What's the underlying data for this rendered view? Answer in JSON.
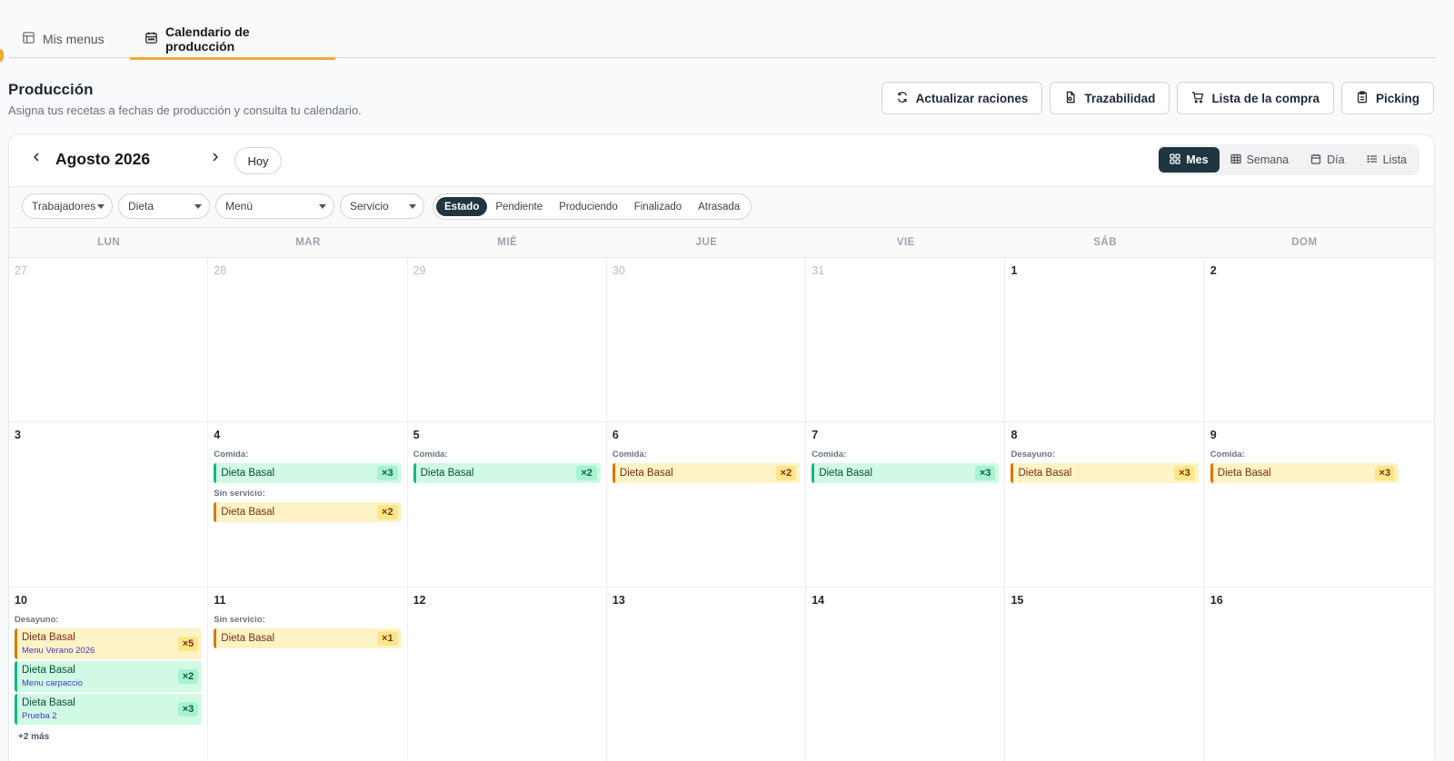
{
  "tabs": [
    {
      "label": "Mis menus"
    },
    {
      "label": "Calendario de producción"
    }
  ],
  "header": {
    "title": "Producción",
    "subtitle": "Asigna tus recetas a fechas de producción y consulta tu calendario."
  },
  "actions": {
    "update_label": "Actualizar raciones",
    "trace_label": "Trazabilidad",
    "shopping_label": "Lista de la compra",
    "picking_label": "Picking"
  },
  "calendar": {
    "month_title": "Agosto 2026",
    "today_label": "Hoy",
    "views": [
      "Mes",
      "Semana",
      "Día",
      "Lista"
    ],
    "active_view": "Mes",
    "filters": [
      "Trabajadores",
      "Dieta",
      "Menú",
      "Servicio"
    ],
    "status": [
      "Estado",
      "Pendiente",
      "Produciendo",
      "Finalizado",
      "Atrasada"
    ],
    "active_status": "Estado",
    "weekdays": [
      "LUN",
      "MAR",
      "MIÉ",
      "JUE",
      "VIE",
      "SÁB",
      "DOM"
    ],
    "weeks": [
      [
        {
          "num": "27",
          "muted": true,
          "groups": []
        },
        {
          "num": "28",
          "muted": true,
          "groups": []
        },
        {
          "num": "29",
          "muted": true,
          "groups": []
        },
        {
          "num": "30",
          "muted": true,
          "groups": []
        },
        {
          "num": "31",
          "muted": true,
          "groups": []
        },
        {
          "num": "1",
          "muted": false,
          "groups": []
        },
        {
          "num": "2",
          "muted": false,
          "groups": []
        }
      ],
      [
        {
          "num": "3",
          "muted": false,
          "groups": []
        },
        {
          "num": "4",
          "muted": false,
          "groups": [
            {
              "service": "Comida:",
              "events": [
                {
                  "title": "Dieta Basal",
                  "count": "×3",
                  "color": "green"
                }
              ]
            },
            {
              "service": "Sin servicio:",
              "events": [
                {
                  "title": "Dieta Basal",
                  "count": "×2",
                  "color": "amber"
                }
              ]
            }
          ]
        },
        {
          "num": "5",
          "muted": false,
          "groups": [
            {
              "service": "Comida:",
              "events": [
                {
                  "title": "Dieta Basal",
                  "count": "×2",
                  "color": "green"
                }
              ]
            }
          ]
        },
        {
          "num": "6",
          "muted": false,
          "groups": [
            {
              "service": "Comida:",
              "events": [
                {
                  "title": "Dieta Basal",
                  "count": "×2",
                  "color": "amber"
                }
              ]
            }
          ]
        },
        {
          "num": "7",
          "muted": false,
          "groups": [
            {
              "service": "Comida:",
              "events": [
                {
                  "title": "Dieta Basal",
                  "count": "×3",
                  "color": "green"
                }
              ]
            }
          ]
        },
        {
          "num": "8",
          "muted": false,
          "groups": [
            {
              "service": "Desayuno:",
              "events": [
                {
                  "title": "Dieta Basal",
                  "count": "×3",
                  "color": "amber"
                }
              ]
            }
          ]
        },
        {
          "num": "9",
          "muted": false,
          "groups": [
            {
              "service": "Comida:",
              "events": [
                {
                  "title": "Dieta Basal",
                  "count": "×3",
                  "color": "amber"
                }
              ]
            }
          ]
        }
      ],
      [
        {
          "num": "10",
          "muted": false,
          "groups": [
            {
              "service": "Desayuno:",
              "events": [
                {
                  "title": "Dieta Basal",
                  "menu": "Menu Verano 2026",
                  "count": "×5",
                  "color": "amber"
                },
                {
                  "title": "Dieta Basal",
                  "menu": "Menu carpaccio",
                  "count": "×2",
                  "color": "green"
                },
                {
                  "title": "Dieta Basal",
                  "menu": "Prueba 2",
                  "count": "×3",
                  "color": "green"
                }
              ]
            }
          ],
          "more": "+2 más"
        },
        {
          "num": "11",
          "muted": false,
          "groups": [
            {
              "service": "Sin servicio:",
              "events": [
                {
                  "title": "Dieta Basal",
                  "count": "×1",
                  "color": "amber"
                }
              ]
            }
          ]
        },
        {
          "num": "12",
          "muted": false,
          "groups": []
        },
        {
          "num": "13",
          "muted": false,
          "groups": []
        },
        {
          "num": "14",
          "muted": false,
          "groups": []
        },
        {
          "num": "15",
          "muted": false,
          "groups": []
        },
        {
          "num": "16",
          "muted": false,
          "groups": []
        }
      ]
    ]
  },
  "colors": {
    "accent": "#f0a93a",
    "dark": "#1f3540",
    "event_green": "#10b981",
    "event_amber": "#d97706"
  }
}
